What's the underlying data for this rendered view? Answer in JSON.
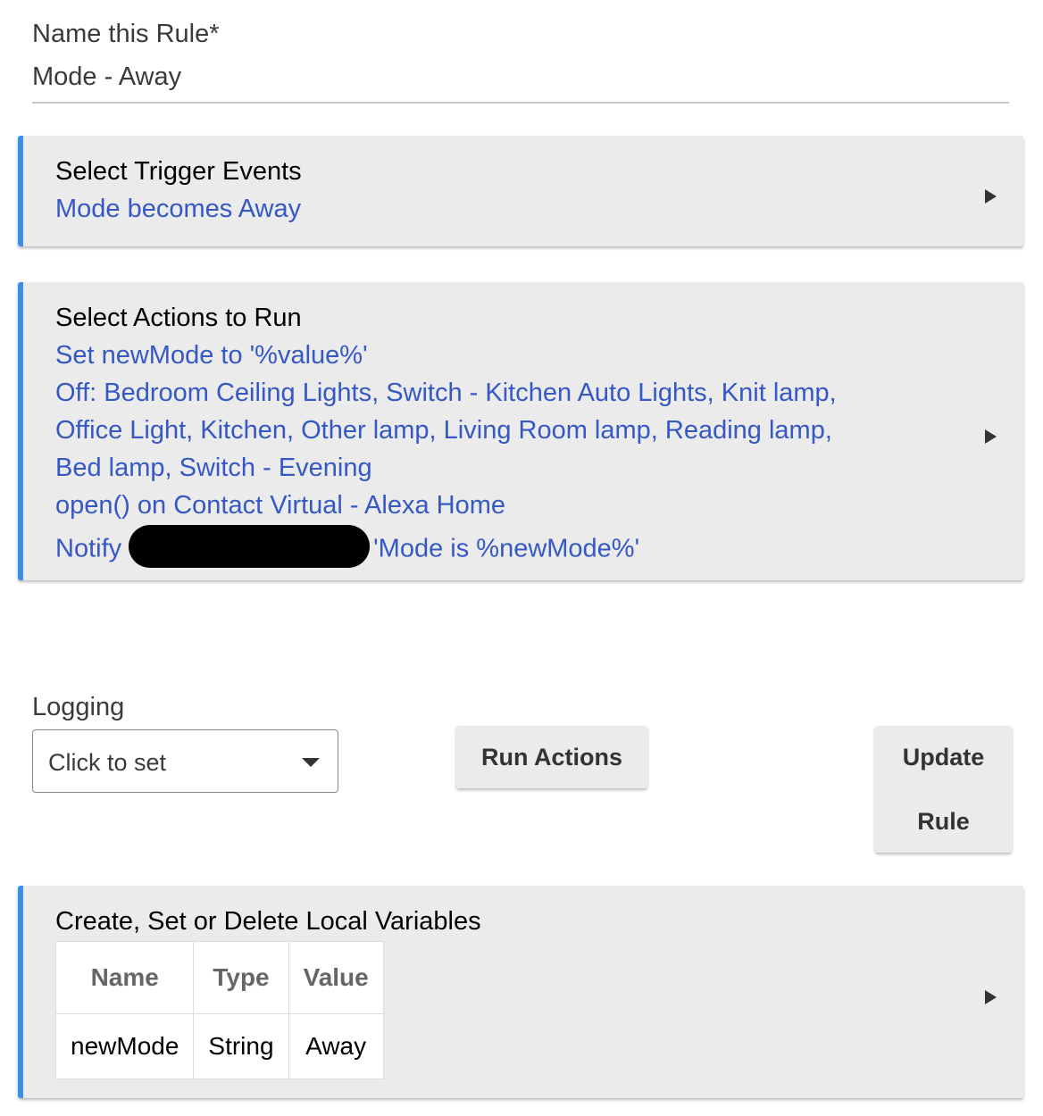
{
  "rule_name": {
    "label": "Name this Rule*",
    "value": "Mode - Away"
  },
  "trigger_section": {
    "title": "Select Trigger Events",
    "lines": [
      "Mode becomes Away"
    ]
  },
  "actions_section": {
    "title": "Select Actions to Run",
    "lines": [
      "Set newMode to '%value%'",
      "Off: Bedroom Ceiling Lights, Switch - Kitchen Auto Lights, Knit lamp,",
      "Office Light, Kitchen, Other lamp, Living Room lamp, Reading lamp,",
      "Bed lamp, Switch - Evening",
      "open() on Contact Virtual - Alexa Home"
    ],
    "notify_prefix": "Notify",
    "notify_message": "'Mode is %newMode%'"
  },
  "logging": {
    "label": "Logging",
    "selected": "Click to set"
  },
  "buttons": {
    "run_actions": "Run Actions",
    "update_line1": "Update",
    "update_line2": "Rule"
  },
  "variables_section": {
    "title": "Create, Set or Delete Local Variables",
    "columns": [
      "Name",
      "Type",
      "Value"
    ],
    "rows": [
      [
        "newMode",
        "String",
        "Away"
      ]
    ]
  },
  "colors": {
    "accent_border": "#3d8fe6",
    "link_text": "#3558c4",
    "section_bg": "#ebebeb"
  },
  "icons": {
    "section_arrow": "play-arrow-icon",
    "dropdown_caret": "caret-down-icon"
  }
}
